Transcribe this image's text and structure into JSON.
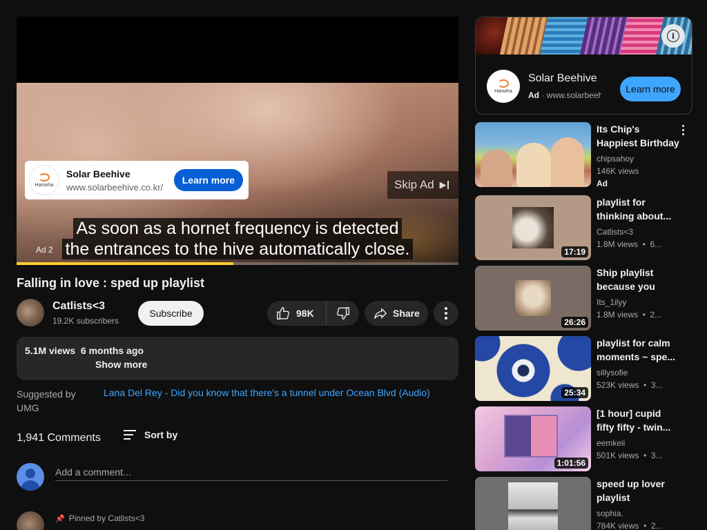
{
  "player": {
    "ad_card": {
      "brand": "Hanwha",
      "title": "Solar Beehive",
      "url": "www.solarbeehive.co.kr/",
      "button": "Learn more"
    },
    "skip_label": "Skip Ad",
    "captions": [
      "As soon as a hornet frequency is detected",
      "the entrances to the hive automatically close."
    ],
    "ad_label": "Ad 2",
    "progress_fraction": 0.49
  },
  "video": {
    "title": "Falling in love : sped up playlist",
    "channel": "Catlists<3",
    "subscribers": "19.2K subscribers",
    "subscribe_label": "Subscribe",
    "likes": "98K",
    "share_label": "Share"
  },
  "description": {
    "views_date": "5.1M views  6 months ago",
    "show_more": "Show more"
  },
  "suggested": {
    "label": "Suggested by UMG",
    "link": "Lana Del Rey - Did you know that there's a tunnel under Ocean Blvd (Audio)"
  },
  "comments": {
    "count": "1,941 Comments",
    "sort_label": "Sort by",
    "input_placeholder": "Add a comment...",
    "pinned_label": "Pinned by Catlists<3"
  },
  "side_ad": {
    "brand": "Hanwha",
    "title": "Solar Beehive",
    "ad_tag": "Ad",
    "url": "www.solarbeehive.co.kr/",
    "button": "Learn more"
  },
  "recommendations": [
    {
      "title": "Its Chip's Happiest Birthday",
      "channel": "chipsahoy",
      "meta": "146K views",
      "badge": "Ad",
      "duration": ""
    },
    {
      "title": "playlist for thinking about...",
      "channel": "Catlists<3",
      "meta": "1.8M views  •  6...",
      "badge": "",
      "duration": "17:19"
    },
    {
      "title": "Ship playlist because you are...",
      "channel": "Its_1ilyy",
      "meta": "1.8M views  •  2...",
      "badge": "",
      "duration": "26:26"
    },
    {
      "title": "playlist for calm moments ~ spe...",
      "channel": "sillysofie",
      "meta": "523K views  •  3...",
      "badge": "",
      "duration": "25:34"
    },
    {
      "title": "[1 hour] cupid fifty fifty - twin...",
      "channel": "eemkeii",
      "meta": "501K views  •  3...",
      "badge": "",
      "duration": "1:01:56"
    },
    {
      "title": "speed up lover playlist",
      "channel": "sophia.",
      "meta": "784K views  •  2...",
      "badge": "",
      "duration": ""
    }
  ],
  "colors": {
    "background": "#0f0f0f",
    "accent_blue": "#3ea6ff",
    "ad_button_blue": "#065fd4",
    "progress_yellow": "#fcd02f"
  }
}
